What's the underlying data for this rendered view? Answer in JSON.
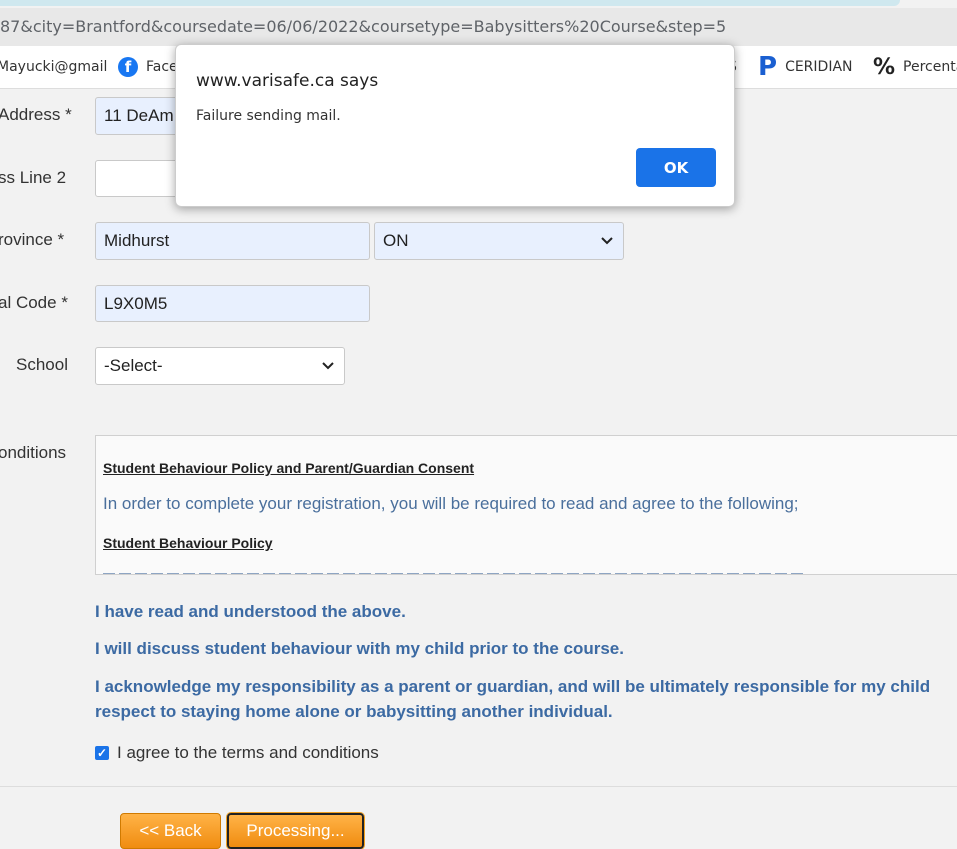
{
  "browser": {
    "url": "87&city=Brantford&coursedate=06/06/2022&coursetype=Babysitters%20Course&step=5",
    "bookmarks": [
      {
        "label": "Mayucki@gmail",
        "icon": "none"
      },
      {
        "label": "Face",
        "icon": "facebook-icon"
      },
      {
        "label": "S",
        "icon": "none"
      },
      {
        "label": "CERIDIAN",
        "icon": "ceridian-p-icon"
      },
      {
        "label": "Percenta",
        "icon": "percent-icon"
      }
    ]
  },
  "form": {
    "address_label": "Address *",
    "address_value": "11 DeAm",
    "address2_label": "ss Line 2",
    "address2_value": "",
    "province_label": "rovince *",
    "city_value": "Midhurst",
    "province_value": "ON",
    "postal_label": "al Code *",
    "postal_value": "L9X0M5",
    "school_label": "School",
    "school_value": "-Select-",
    "conditions_label": "onditions"
  },
  "terms": {
    "heading1": "Student Behaviour Policy and Parent/Guardian Consent",
    "intro": "In order to complete your registration, you will be required to read and agree to the following;",
    "heading2": "Student Behaviour Policy"
  },
  "acknowledgements": {
    "line1": "I have read and understood the above.",
    "line2": "I will discuss student behaviour with my child prior to the course.",
    "line3a": "I acknowledge my responsibility as a parent or guardian, and will be ultimately responsible for my child",
    "line3b": "respect to staying home alone or babysitting another individual."
  },
  "agree": {
    "label": "I agree to the terms and conditions",
    "checked": true
  },
  "buttons": {
    "back": "<< Back",
    "processing": "Processing..."
  },
  "dialog": {
    "title": "www.varisafe.ca says",
    "message": "Failure sending mail.",
    "ok": "OK"
  },
  "colors": {
    "accent_blue": "#1a73e8",
    "button_orange": "#f5a01e",
    "ack_text": "#3c6aa3"
  }
}
